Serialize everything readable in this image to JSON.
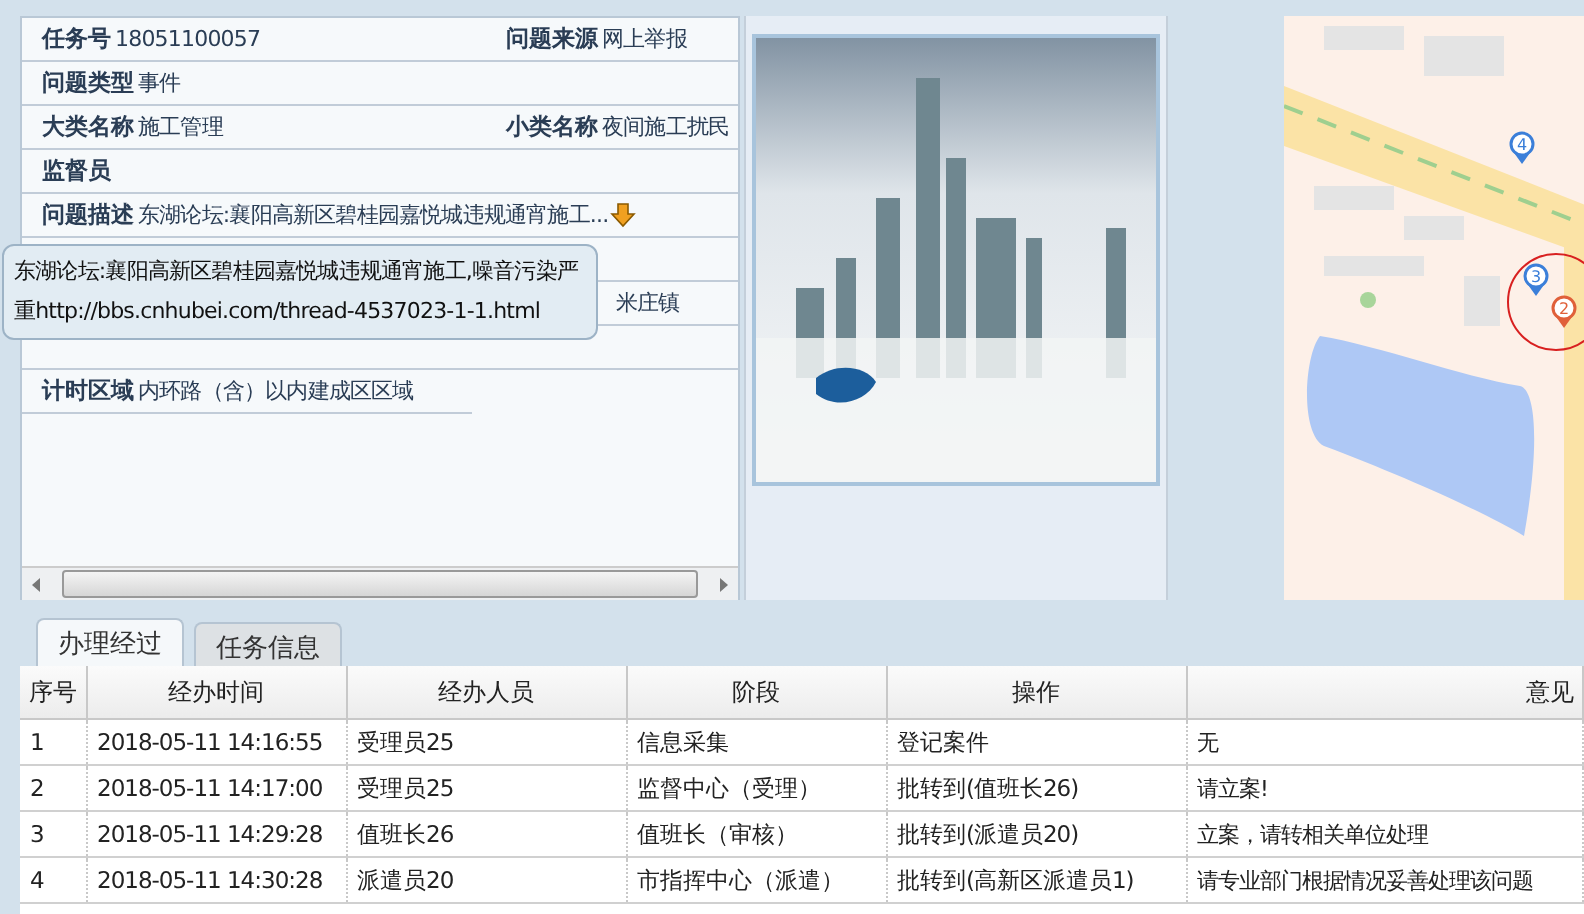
{
  "task_info": {
    "rows": [
      {
        "label": "任务号",
        "value": "18051100057",
        "label_2": "问题来源",
        "value_2": "网上举报"
      },
      {
        "label": "问题类型",
        "value": "事件"
      },
      {
        "label": "大类名称",
        "value": "施工管理",
        "label_2": "小类名称",
        "value_2": "夜间施工扰民"
      },
      {
        "label": "监督员"
      },
      {
        "label": "问题描述",
        "value": "东湖论坛:襄阳高新区碧桂园嘉悦城违规通宵施工...",
        "expandable": true
      },
      {},
      {
        "value_2": "米庄镇"
      },
      {},
      {
        "label": "计时区域",
        "value": "内环路（含）以内建成区区域"
      }
    ],
    "tooltip": "东湖论坛:襄阳高新区碧桂园嘉悦城违规通宵施工,噪音污染严重http://bbs.cnhubei.com/thread-4537023-1-1.html"
  },
  "map": {
    "markers": [
      {
        "label": "4",
        "color": "#3b7fd9"
      },
      {
        "label": "3",
        "color": "#3b7fd9"
      },
      {
        "label": "2",
        "color": "#e0603a"
      }
    ]
  },
  "tabs": [
    {
      "label": "办理经过",
      "selected": true
    },
    {
      "label": "任务信息",
      "selected": false
    }
  ],
  "table": {
    "columns": [
      "序号",
      "经办时间",
      "经办人员",
      "阶段",
      "操作",
      "意见"
    ],
    "rows": [
      [
        "1",
        "2018-05-11 14:16:55",
        "受理员25",
        "信息采集",
        "登记案件",
        "无"
      ],
      [
        "2",
        "2018-05-11 14:17:00",
        "受理员25",
        "监督中心（受理）",
        "批转到(值班长26)",
        "请立案!"
      ],
      [
        "3",
        "2018-05-11 14:29:28",
        "值班长26",
        "值班长（审核）",
        "批转到(派遣员20)",
        "立案，请转相关单位处理"
      ],
      [
        "4",
        "2018-05-11 14:30:28",
        "派遣员20",
        "市指挥中心（派遣）",
        "批转到(高新区派遣员1)",
        "请专业部门根据情况妥善处理该问题"
      ]
    ]
  }
}
